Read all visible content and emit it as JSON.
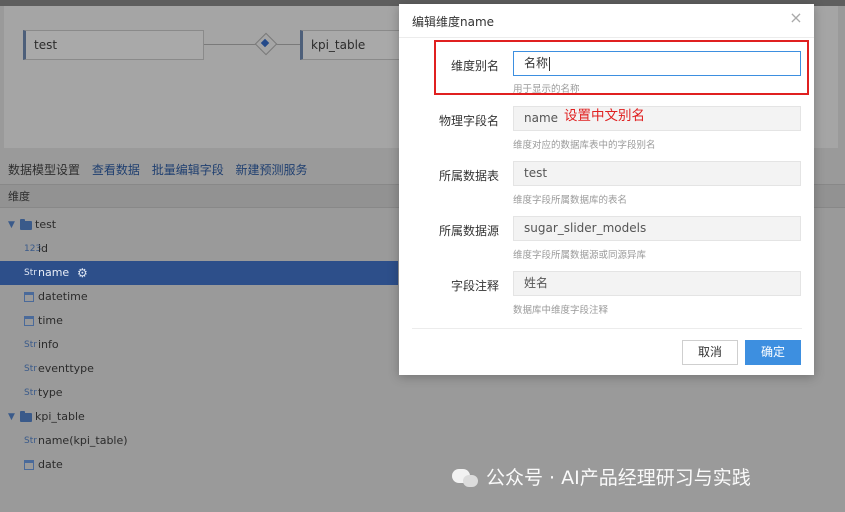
{
  "canvas": {
    "left_table": "test",
    "right_table": "kpi_table"
  },
  "tabs": [
    {
      "label": "数据模型设置"
    },
    {
      "label": "查看数据"
    },
    {
      "label": "批量编辑字段"
    },
    {
      "label": "新建预测服务"
    }
  ],
  "dimension_header": "维度",
  "tree": {
    "groups": [
      {
        "label": "test"
      },
      {
        "label": "kpi_table"
      }
    ],
    "items": [
      {
        "type_icon": "123",
        "label": "id"
      },
      {
        "type_icon": "Str",
        "label": "name"
      },
      {
        "type_icon": "datetime-icon",
        "label": "datetime"
      },
      {
        "type_icon": "calendar-icon",
        "label": "time"
      },
      {
        "type_icon": "Str",
        "label": "info"
      },
      {
        "type_icon": "Str",
        "label": "eventtype"
      },
      {
        "type_icon": "Str",
        "label": "type"
      },
      {
        "type_icon": "Str",
        "label": "name(kpi_table)"
      },
      {
        "type_icon": "calendar-icon",
        "label": "date"
      }
    ]
  },
  "dialog": {
    "title": "编辑维度name",
    "close_symbol": "×",
    "fields": [
      {
        "label": "维度别名",
        "value": "名称",
        "hint": "用于显示的名称"
      },
      {
        "label": "物理字段名",
        "value": "name",
        "hint": "维度对应的数据库表中的字段别名"
      },
      {
        "label": "所属数据表",
        "value": "test",
        "hint": "维度字段所属数据库的表名"
      },
      {
        "label": "所属数据源",
        "value": "sugar_slider_models",
        "hint": "维度字段所属数据源或同源异库"
      },
      {
        "label": "字段注释",
        "value": "姓名",
        "hint": "数据库中维度字段注释"
      }
    ],
    "annotation": "设置中文别名",
    "cancel_label": "取消",
    "ok_label": "确定"
  },
  "watermark": "公众号 · AI产品经理研习与实践",
  "colors": {
    "primary": "#3d8fe0",
    "annotation_red": "#e02020",
    "selected_row": "#2d4f8a"
  }
}
